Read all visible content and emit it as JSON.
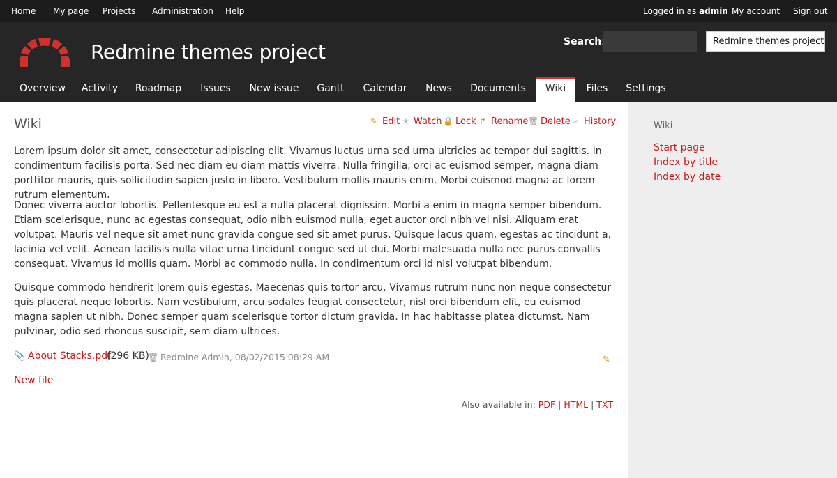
{
  "top_menu": {
    "items": [
      "Home",
      "My page",
      "Projects",
      "Administration",
      "Help"
    ],
    "logged_prefix": "Logged in as",
    "user": "admin",
    "my_account": "My account",
    "sign_out": "Sign out"
  },
  "header": {
    "title": "Redmine themes project",
    "search_label": "Search:",
    "search_value": "",
    "project_select": "Redmine themes project"
  },
  "tabs": [
    {
      "label": "Overview"
    },
    {
      "label": "Activity"
    },
    {
      "label": "Roadmap"
    },
    {
      "label": "Issues"
    },
    {
      "label": "New issue"
    },
    {
      "label": "Gantt"
    },
    {
      "label": "Calendar"
    },
    {
      "label": "News"
    },
    {
      "label": "Documents"
    },
    {
      "label": "Wiki",
      "selected": true
    },
    {
      "label": "Files"
    },
    {
      "label": "Settings"
    }
  ],
  "wiki": {
    "title": "Wiki",
    "actions": {
      "edit": "Edit",
      "watch": "Watch",
      "lock": "Lock",
      "rename": "Rename",
      "delete": "Delete",
      "history": "History"
    },
    "paragraphs": [
      "Lorem ipsum dolor sit amet, consectetur adipiscing elit. Vivamus luctus urna sed urna ultricies ac tempor dui sagittis. In condimentum facilisis porta. Sed nec diam eu diam mattis viverra. Nulla fringilla, orci ac euismod semper, magna diam porttitor mauris, quis sollicitudin sapien justo in libero. Vestibulum mollis mauris enim. Morbi euismod magna ac lorem rutrum elementum.",
      "Donec viverra auctor lobortis. Pellentesque eu est a nulla placerat dignissim. Morbi a enim in magna semper bibendum. Etiam scelerisque, nunc ac egestas consequat, odio nibh euismod nulla, eget auctor orci nibh vel nisi. Aliquam erat volutpat. Mauris vel neque sit amet nunc gravida congue sed sit amet purus. Quisque lacus quam, egestas ac tincidunt a, lacinia vel velit. Aenean facilisis nulla vitae urna tincidunt congue sed ut dui. Morbi malesuada nulla nec purus convallis consequat. Vivamus id mollis quam. Morbi ac commodo nulla. In condimentum orci id nisl volutpat bibendum.",
      "Quisque commodo hendrerit lorem quis egestas. Maecenas quis tortor arcu. Vivamus rutrum nunc non neque consectetur quis placerat neque lobortis. Nam vestibulum, arcu sodales feugiat consectetur, nisl orci bibendum elit, eu euismod magna sapien ut nibh. Donec semper quam scelerisque tortor dictum gravida. In hac habitasse platea dictumst. Nam pulvinar, odio sed rhoncus suscipit, sem diam ultrices."
    ],
    "attachment": {
      "filename": "About Stacks.pdf",
      "size": "(296 KB)",
      "author_date": "Redmine Admin, 08/02/2015 08:29 AM"
    },
    "new_file": "New file",
    "other_formats": {
      "prefix": "Also available in:",
      "formats": [
        "PDF",
        "HTML",
        "TXT"
      ],
      "separator": "|"
    }
  },
  "sidebar": {
    "heading": "Wiki",
    "links": [
      "Start page",
      "Index by title",
      "Index by date"
    ]
  },
  "colors": {
    "accent": "#c61a1a",
    "header_bg": "#262626",
    "topbar_bg": "#1c1c1c",
    "sidebar_bg": "#eeeeee"
  },
  "icons": {
    "logo": "redmine-logo",
    "edit": "pencil-icon",
    "watch": "star-icon",
    "lock": "lock-icon",
    "rename": "rename-arrow-icon",
    "delete": "trash-icon",
    "history": "history-icon",
    "attachment": "paperclip-icon"
  }
}
